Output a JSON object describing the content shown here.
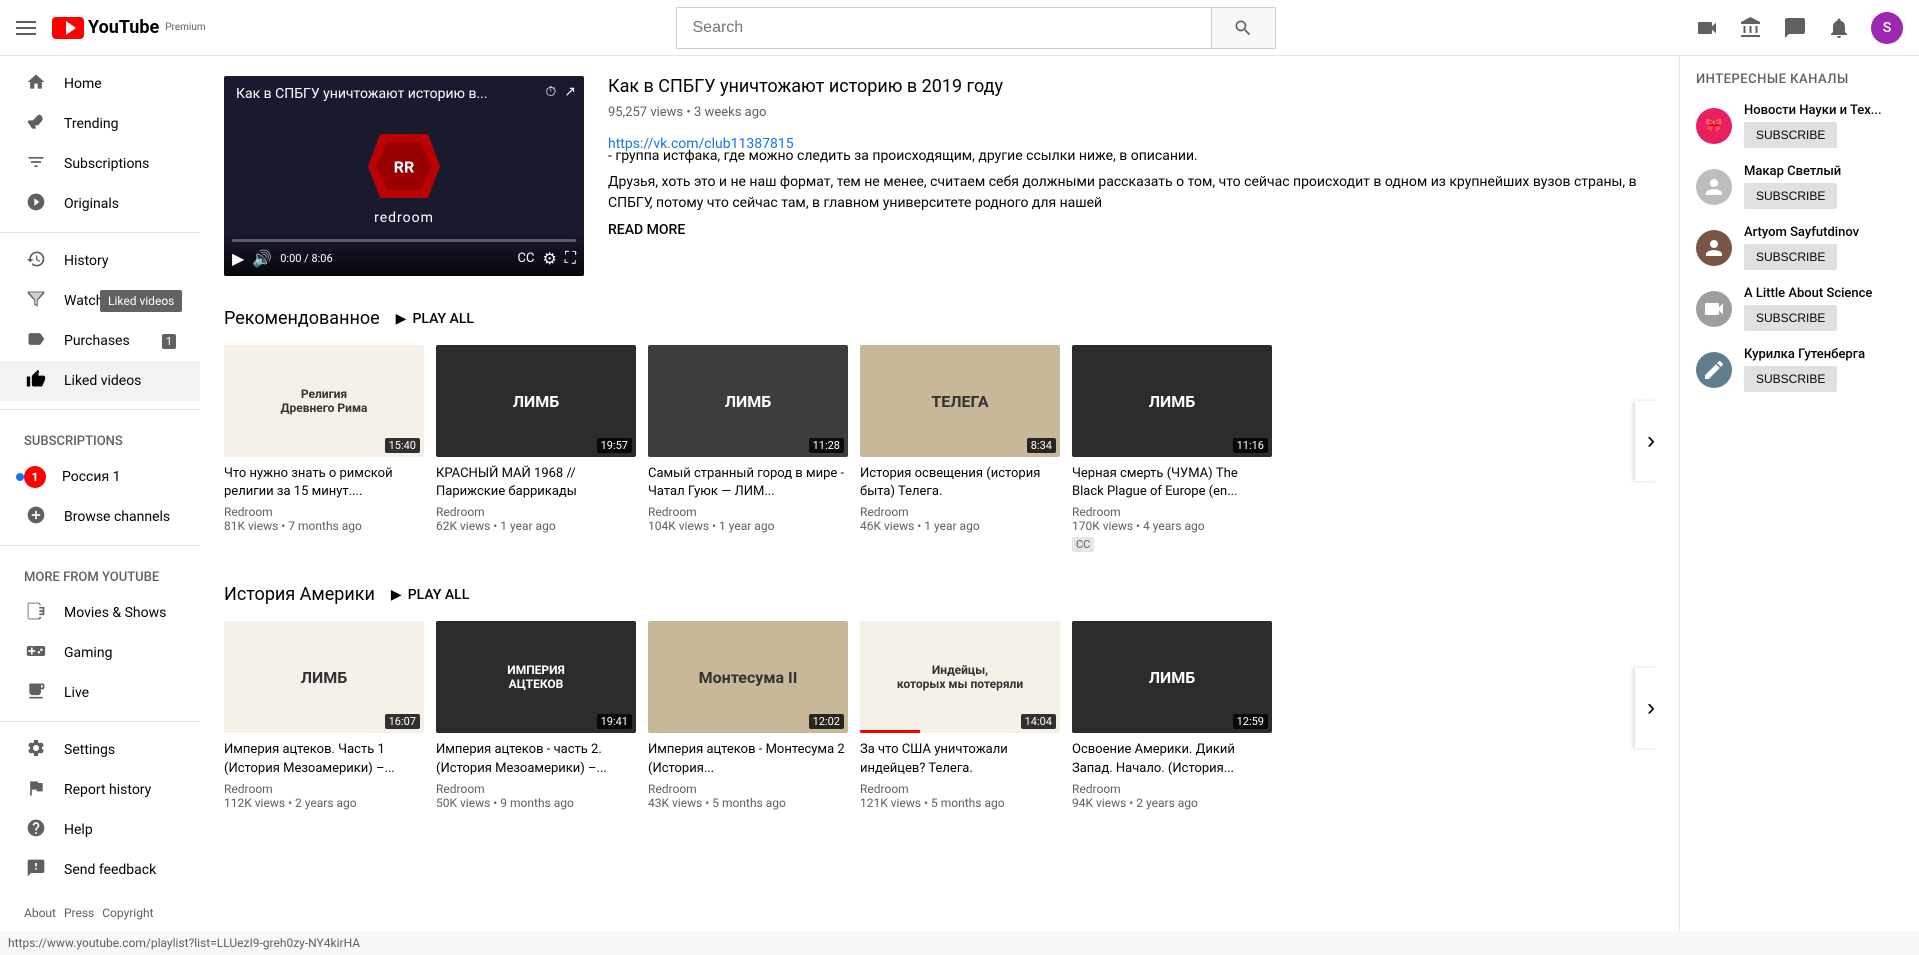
{
  "header": {
    "menu_icon": "☰",
    "logo_text": "YouTube",
    "logo_premium": "Premium",
    "search_placeholder": "Search",
    "search_icon": "🔍",
    "create_icon": "📹",
    "apps_icon": "⋮⋮⋮",
    "message_icon": "💬",
    "bell_icon": "🔔",
    "avatar_initial": "S"
  },
  "sidebar": {
    "items": [
      {
        "id": "home",
        "label": "Home",
        "icon": "🏠"
      },
      {
        "id": "trending",
        "label": "Trending",
        "icon": "🔥"
      },
      {
        "id": "subscriptions",
        "label": "Subscriptions",
        "icon": "📺"
      },
      {
        "id": "originals",
        "label": "Originals",
        "icon": "▶"
      }
    ],
    "section2": [
      {
        "id": "history",
        "label": "History",
        "icon": "🕐"
      },
      {
        "id": "watch-later",
        "label": "Watch later",
        "icon": "🕐",
        "tooltip": "Liked videos"
      },
      {
        "id": "purchases",
        "label": "Purchases",
        "icon": "🏷",
        "badge": "1"
      },
      {
        "id": "liked-videos",
        "label": "Liked videos",
        "icon": "👍"
      }
    ],
    "subscriptions_label": "SUBSCRIPTIONS",
    "subscriptions": [
      {
        "id": "russia1",
        "label": "Россия 1",
        "has_dot": true
      }
    ],
    "browse_channels": "Browse channels",
    "more_label": "MORE FROM YOUTUBE",
    "more_items": [
      {
        "id": "movies",
        "label": "Movies & Shows",
        "icon": "🎬"
      },
      {
        "id": "gaming",
        "label": "Gaming",
        "icon": "🎮"
      },
      {
        "id": "live",
        "label": "Live",
        "icon": "📡"
      }
    ],
    "bottom_items": [
      {
        "id": "settings",
        "label": "Settings",
        "icon": "⚙"
      },
      {
        "id": "report",
        "label": "Report history",
        "icon": "🚩"
      },
      {
        "id": "help",
        "label": "Help",
        "icon": "❓"
      },
      {
        "id": "feedback",
        "label": "Send feedback",
        "icon": "❗"
      }
    ],
    "footer": [
      "About",
      "Press",
      "Copyright"
    ]
  },
  "featured_video": {
    "title": "Как в СПБГУ уничтожают историю в 2019 году",
    "views": "95,257 views",
    "time": "3 weeks ago",
    "link": "https://vk.com/club11387815",
    "link_desc": " - группа истфака, где можно следить за происходящим, другие ссылки ниже, в описании.",
    "description": "Друзья, хоть это и не наш формат, тем не менее, считаем себя должными рассказать о том, что сейчас происходит в одном из крупнейших вузов страны, в СПБГУ, потому что сейчас там, в главном университете родного для нашей",
    "read_more": "READ MORE",
    "player_title": "Как в СПБГУ уничтожают историю в...",
    "duration": "8:06",
    "time_display": "0:00 / 8:06"
  },
  "section1": {
    "title": "Рекомендованное",
    "play_all": "PLAY ALL",
    "videos": [
      {
        "title": "Что нужно знать о римской религии за 15 минут....",
        "channel": "Redroom",
        "views": "81K views",
        "ago": "7 months ago",
        "duration": "15:40",
        "bg": "thumb-bg-1",
        "text_overlay": "Религия\nДревнего Рима"
      },
      {
        "title": "КРАСНЫЙ МАЙ 1968 // Парижские баррикады",
        "channel": "Redroom",
        "views": "62K views",
        "ago": "1 year ago",
        "duration": "19:57",
        "bg": "thumb-bg-2",
        "text_overlay": "ЛИМБ"
      },
      {
        "title": "Самый странный город в мире - Чатал Гуюк — ЛИМ...",
        "channel": "Redroom",
        "views": "104K views",
        "ago": "1 year ago",
        "duration": "11:28",
        "bg": "thumb-bg-3",
        "text_overlay": "ЛИМБ"
      },
      {
        "title": "История освещения (история быта) Телега.",
        "channel": "Redroom",
        "views": "46K views",
        "ago": "1 year ago",
        "duration": "8:34",
        "bg": "thumb-bg-4",
        "text_overlay": "ТЕЛЕГА"
      },
      {
        "title": "Черная смерть (ЧУМА) The Black Plague of Europe (en...",
        "channel": "Redroom",
        "views": "170K views",
        "ago": "4 years ago",
        "duration": "11:16",
        "bg": "thumb-bg-2",
        "text_overlay": "ЛИМБ",
        "cc": "CC"
      }
    ]
  },
  "section2": {
    "title": "История Америки",
    "play_all": "PLAY ALL",
    "videos": [
      {
        "title": "Империя ацтеков. Часть 1 (История Мезоамерики) –...",
        "channel": "Redroom",
        "views": "112K views",
        "ago": "2 years ago",
        "duration": "16:07",
        "bg": "thumb-bg-1",
        "text_overlay": "ЛИМБ"
      },
      {
        "title": "Империя ацтеков - часть 2. (История Мезоамерики) –...",
        "channel": "Redroom",
        "views": "50K views",
        "ago": "9 months ago",
        "duration": "19:41",
        "bg": "thumb-bg-2",
        "text_overlay": "ИМПЕРИЯ\nАЦТЕКОВ"
      },
      {
        "title": "Империя ацтеков - Монтесума 2 (История...",
        "channel": "Redroom",
        "views": "43K views",
        "ago": "5 months ago",
        "duration": "12:02",
        "bg": "thumb-bg-4",
        "text_overlay": "Монтесума II"
      },
      {
        "title": "За что США уничтожали индейцев? Телега.",
        "channel": "Redroom",
        "views": "121K views",
        "ago": "5 months ago",
        "duration": "14:04",
        "bg": "thumb-bg-1",
        "text_overlay": "Индейцы,\nкоторых мы потеряли",
        "progress": "30"
      },
      {
        "title": "Освоение Америки. Дикий Запад. Начало. (История...",
        "channel": "Redroom",
        "views": "94K views",
        "ago": "2 years ago",
        "duration": "12:59",
        "bg": "thumb-bg-2",
        "text_overlay": "ЛИМБ"
      }
    ]
  },
  "right_sidebar": {
    "title": "ИНТЕРЕСНЫЕ КАНАЛЫ",
    "channels": [
      {
        "id": "ch1",
        "name": "Новости Науки и Тех...",
        "avatar_bg": "#e91e63",
        "avatar_icon": "🎀",
        "subscribe": "SUBSCRIBE"
      },
      {
        "id": "ch2",
        "name": "Макар Светлый",
        "avatar_bg": "#9e9e9e",
        "avatar_icon": "👤",
        "subscribe": "SUBSCRIBE"
      },
      {
        "id": "ch3",
        "name": "Artyom Sayfutdinov",
        "avatar_bg": "#795548",
        "avatar_img": true,
        "subscribe": "SUBSCRIBE"
      },
      {
        "id": "ch4",
        "name": "A Little About Science",
        "avatar_bg": "#9e9e9e",
        "avatar_icon": "📺",
        "subscribe": "SUBSCRIBE"
      },
      {
        "id": "ch5",
        "name": "Курилка Гутенберга",
        "avatar_bg": "#607d8b",
        "avatar_icon": "✏",
        "subscribe": "SUBSCRIBE"
      }
    ]
  },
  "status_bar": {
    "url": "https://www.youtube.com/playlist?list=LLUezI9-greh0zy-NY4kirHA"
  }
}
